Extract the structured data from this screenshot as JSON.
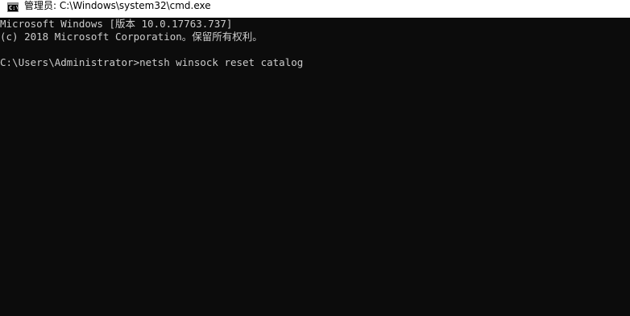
{
  "window": {
    "title": "管理员: C:\\Windows\\system32\\cmd.exe",
    "icon": "cmd-console-icon",
    "icon_glyph": "C:\\",
    "colors": {
      "background": "#0c0c0c",
      "text": "#cccccc",
      "titlebar": "#ffffff"
    }
  },
  "console": {
    "lines": [
      "Microsoft Windows [版本 10.0.17763.737]",
      "(c) 2018 Microsoft Corporation。保留所有权利。",
      "",
      "C:\\Users\\Administrator>netsh winsock reset catalog"
    ]
  }
}
